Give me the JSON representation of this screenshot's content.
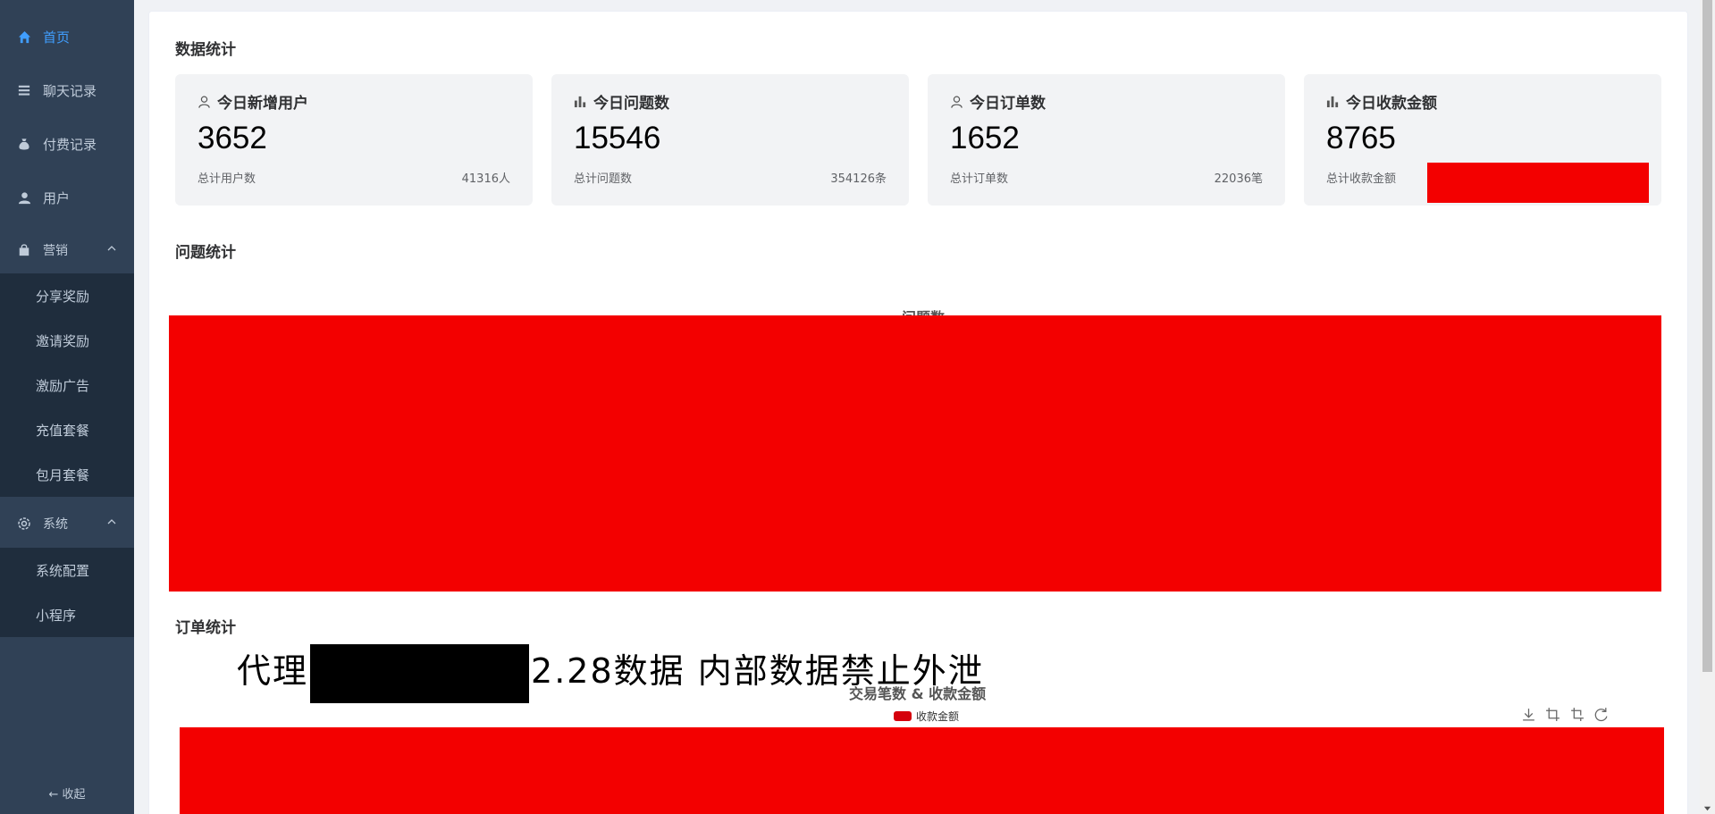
{
  "sidebar": {
    "items": [
      {
        "label": "首页",
        "icon": "home-icon",
        "active": true
      },
      {
        "label": "聊天记录",
        "icon": "list-icon"
      },
      {
        "label": "付费记录",
        "icon": "money-bag-icon"
      },
      {
        "label": "用户",
        "icon": "user-icon"
      },
      {
        "label": "营销",
        "icon": "shopping-bag-icon",
        "expanded": true
      },
      {
        "label": "系统",
        "icon": "gear-icon",
        "expanded": true
      }
    ],
    "marketing_sub": [
      "分享奖励",
      "邀请奖励",
      "激励广告",
      "充值套餐",
      "包月套餐"
    ],
    "system_sub": [
      "系统配置",
      "小程序"
    ],
    "collapse_label": "收起"
  },
  "sections": {
    "data_stats": "数据统计",
    "question_stats": "问题统计",
    "order_stats": "订单统计"
  },
  "cards": [
    {
      "title": "今日新增用户",
      "icon": "user-icon",
      "value": "3652",
      "foot_label": "总计用户数",
      "foot_value": "41316人"
    },
    {
      "title": "今日问题数",
      "icon": "bar-chart-icon",
      "value": "15546",
      "foot_label": "总计问题数",
      "foot_value": "354126条"
    },
    {
      "title": "今日订单数",
      "icon": "user-icon",
      "value": "1652",
      "foot_label": "总计订单数",
      "foot_value": "22036笔"
    },
    {
      "title": "今日收款金额",
      "icon": "bar-chart-icon",
      "value": "8765",
      "foot_label": "总计收款金额",
      "foot_value": ""
    }
  ],
  "charts": {
    "question_chart_title": "问题数",
    "order_chart_title": "交易笔数 & 收款金额",
    "order_legend": "收款金额"
  },
  "watermark": {
    "prefix": "代理",
    "suffix": "2.28数据 内部数据禁止外泄"
  },
  "colors": {
    "sidebar_bg": "#304156",
    "accent": "#409eff",
    "redaction": "#f30000",
    "legend_swatch": "#d5000c"
  }
}
